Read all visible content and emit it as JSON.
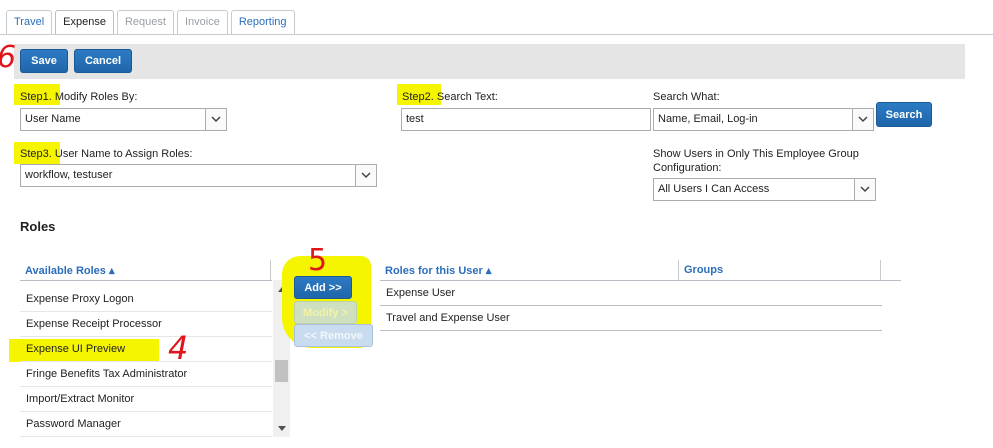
{
  "tabs": [
    {
      "label": "Travel",
      "state": "normal"
    },
    {
      "label": "Expense",
      "state": "active"
    },
    {
      "label": "Request",
      "state": "disabled"
    },
    {
      "label": "Invoice",
      "state": "disabled"
    },
    {
      "label": "Reporting",
      "state": "normal"
    }
  ],
  "toolbar": {
    "save_label": "Save",
    "cancel_label": "Cancel"
  },
  "annotations": {
    "save_step": "6",
    "select_step": "4",
    "add_step": "5"
  },
  "step1": {
    "step_label": "Step1.",
    "label": "Modify Roles By:",
    "value": "User Name"
  },
  "step2": {
    "step_label": "Step2.",
    "label": "Search Text:",
    "value": "test"
  },
  "search_what": {
    "label": "Search What:",
    "value": "Name, Email, Log-in",
    "button": "Search"
  },
  "step3": {
    "step_label": "Step3.",
    "label": "User Name to Assign Roles:",
    "value": "workflow, testuser"
  },
  "employee_group": {
    "label_line1": "Show Users in Only This Employee Group",
    "label_line2": "Configuration:",
    "value": "All Users I Can Access"
  },
  "roles": {
    "title": "Roles",
    "available_header": "Available Roles ▴",
    "available": [
      "Expense Proxy Logon",
      "Expense Receipt Processor",
      "Expense UI Preview",
      "Fringe Benefits Tax Administrator",
      "Import/Extract Monitor",
      "Password Manager"
    ],
    "selected_index": 2,
    "buttons": {
      "add": "Add >>",
      "modify": "Modify >",
      "remove": "<< Remove"
    },
    "user_header": "Roles for this User ▴",
    "groups_header": "Groups",
    "user_roles": [
      "Expense User",
      "Travel and Expense User"
    ]
  },
  "colors": {
    "accent": "#2a6ebb",
    "button": "#1f66aa",
    "highlight": "#f5f500",
    "annotation": "#e0161b"
  }
}
